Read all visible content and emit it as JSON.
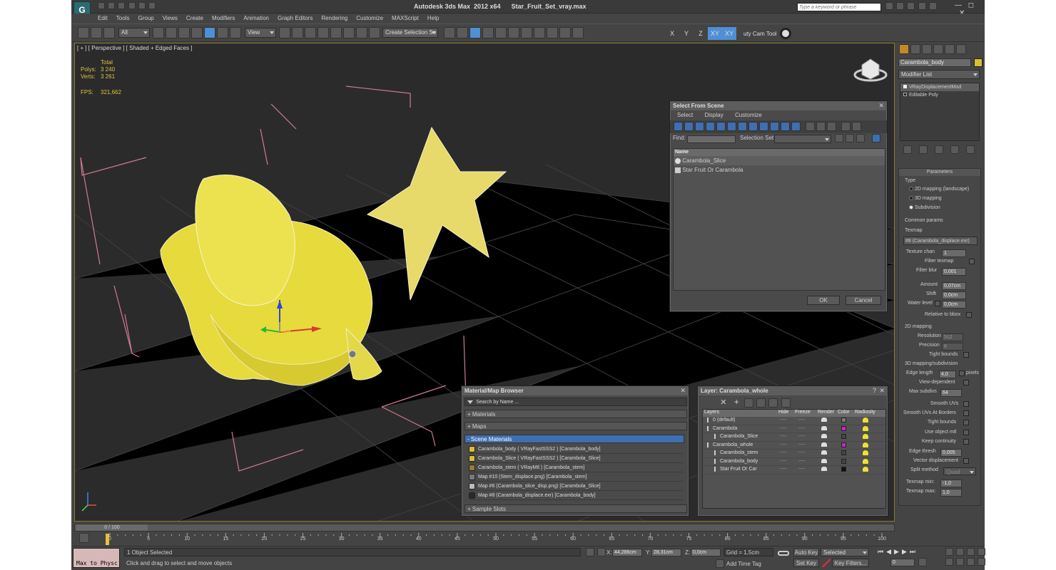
{
  "title": "Autodesk 3ds Max  2012 x64      Star_Fruit_Set_vray.max",
  "search_placeholder": "Type a keyword or phrase",
  "menu": [
    "Edit",
    "Tools",
    "Group",
    "Views",
    "Create",
    "Modifiers",
    "Animation",
    "Graph Editors",
    "Rendering",
    "Customize",
    "MAXScript",
    "Help"
  ],
  "toolbar": {
    "filter": "All",
    "refcoord": "View",
    "selset": "Create Selection Se",
    "axes": [
      "X",
      "Y",
      "Z",
      "XY",
      "XY"
    ],
    "camtool": "uty Cam Tool"
  },
  "viewport": {
    "label": "[ + ] [ Perspective ] [ Shaded + Edged Faces ]",
    "stats": {
      "total": "Total",
      "polys_label": "Polys:",
      "polys": "3 240",
      "verts_label": "Verts:",
      "verts": "3 261",
      "fps_label": "FPS:",
      "fps": "321,662"
    }
  },
  "select_from_scene": {
    "title": "Select From Scene",
    "menu": [
      "Select",
      "Display",
      "Customize"
    ],
    "find_label": "Find:",
    "selset_label": "Selection Set:",
    "col_name": "Name",
    "items": [
      "Carambola_Slice",
      "Star Fruit Or Carambola"
    ],
    "ok": "OK",
    "cancel": "Cancel"
  },
  "mat_browser": {
    "title": "Material/Map Browser",
    "search": "Search by Name ...",
    "sections": [
      "+ Materials",
      "+ Maps",
      "- Scene Materials"
    ],
    "items": [
      "Carambola_body  ( VRayFastSSS2 )  [Carambola_body]",
      "Carambola_Slice  ( VRayFastSSS2 )  [Carambola_Slice]",
      "Carambola_stem  ( VRayMtl )  [Carambola_stem]",
      "Map #10 (Stem_displace.png)  [Carambola_stem]",
      "Map #6 (Carambola_slice_disp.png)  [Carambola_Slice]",
      "Map #8 (Carambola_displace.exr)  [Carambola_body]"
    ],
    "sample_slots": "+ Sample Slots",
    "item_colors": [
      "#d8c030",
      "#d8c030",
      "#9a7a3a",
      "#7a7a7a",
      "#bcbcbc",
      "#2a2a2a"
    ]
  },
  "layer_win": {
    "title": "Layer: Carambola_whole",
    "cols": [
      "Layers",
      "Hide",
      "Freeze",
      "Render",
      "Color",
      "Radiosity"
    ],
    "rows": [
      {
        "name": "0 (default)",
        "color": "#7a7a7a",
        "indent": 0
      },
      {
        "name": "Carambola",
        "color": "#d21fd2",
        "indent": 0
      },
      {
        "name": "Carambola_Slice",
        "color": "#444444",
        "indent": 1
      },
      {
        "name": "Carambola_whole",
        "color": "#d21fd2",
        "indent": 0
      },
      {
        "name": "Carambola_stem",
        "color": "#444444",
        "indent": 1
      },
      {
        "name": "Carambola_body",
        "color": "#444444",
        "indent": 1
      },
      {
        "name": "Star Fruit Or Car",
        "color": "#111111",
        "indent": 1
      }
    ],
    "dash": "----"
  },
  "cmd": {
    "object_name": "Carambola_body",
    "modifier_list": "Modifier List",
    "stack": [
      "VRayDisplacementMod",
      "Editable Poly"
    ],
    "params_title": "Parameters",
    "type_label": "Type",
    "types": [
      "2D mapping (landscape)",
      "3D mapping",
      "Subdivision"
    ],
    "common": "Common params",
    "texmap_label": "Texmap",
    "texmap": "#8 (Carambola_displace.exr)",
    "texture_chan_label": "Texture chan",
    "texture_chan": "1",
    "filter_texmap": "Filter texmap",
    "filter_blur_label": "Filter blur",
    "filter_blur": "0,001",
    "amount_label": "Amount",
    "amount": "0,07cm",
    "shift_label": "Shift",
    "shift": "0,0cm",
    "water_label": "Water level",
    "water": "0,0cm",
    "relative": "Relative to bbox",
    "map2d": "2D mapping",
    "resolution_label": "Resolution",
    "resolution": "512",
    "precision_label": "Precision",
    "precision": "8",
    "tight1": "Tight bounds",
    "map3d": "3D mapping/subdivision",
    "edge_label": "Edge length",
    "edge": "4,0",
    "pixels": "pixels",
    "viewdep": "View-dependent",
    "maxsub_label": "Max subdivs",
    "maxsub": "64",
    "smooth_uvs": "Smooth UVs",
    "smooth_borders": "Smooth UVs At Borders",
    "tight2": "Tight bounds",
    "use_obj": "Use object mtl",
    "keep": "Keep continuity",
    "thresh_label": "Edge thresh",
    "thresh": "0,005",
    "vector": "Vector displacement",
    "split_label": "Split method",
    "split": "Quad",
    "tmin_label": "Texmap min:",
    "tmin": "-1,0",
    "tmax_label": "Texmap max:",
    "tmax": "1,0"
  },
  "timeline": {
    "slider": "0 / 100",
    "ticks": [
      "0",
      "5",
      "10",
      "15",
      "20",
      "25",
      "30",
      "35",
      "40",
      "45",
      "50",
      "55",
      "60",
      "65",
      "70",
      "75",
      "80",
      "85",
      "90",
      "95",
      "100"
    ]
  },
  "status": {
    "maxscript": "Max to Physc",
    "selected": "1 Object Selected",
    "prompt": "Click and drag to select and move objects",
    "x_label": "X:",
    "x": "44,286cm",
    "y_label": "Y:",
    "y": "28,31cm",
    "z_label": "Z:",
    "z": "0,0cm",
    "grid": "Grid = 1,5cm",
    "add_time_tag": "Add Time Tag",
    "auto_key": "Auto Key",
    "set_key": "Set Key",
    "key_mode": "Selected",
    "key_filters": "Key Filters...",
    "frame": "0"
  }
}
